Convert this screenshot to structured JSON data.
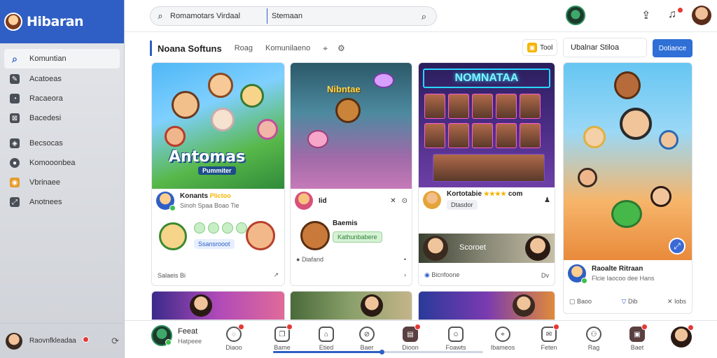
{
  "brand": {
    "title": "Hibaran"
  },
  "sidebar": {
    "items": [
      {
        "label": "Komuntian"
      },
      {
        "label": "Acatoeas"
      },
      {
        "label": "Racaeora"
      },
      {
        "label": "Bacedesi"
      },
      {
        "label": "Becsocas"
      },
      {
        "label": "Komooonbea"
      },
      {
        "label": "Vbrinaee"
      },
      {
        "label": "Anotnees"
      }
    ],
    "user": {
      "name": "Raovnfkleadaa"
    }
  },
  "search": {
    "value": "Romamotars Virdaal",
    "value2": "Stemaan"
  },
  "toolbar": {
    "title": "Noana Softuns",
    "tabs": [
      "Roag",
      "Komunilaeno"
    ],
    "food_label": "Tool",
    "status_label": "Ubalnar Stiloa",
    "primary_label": "Dotiance"
  },
  "cards": {
    "c1": {
      "art_title": "Antomas",
      "art_sub": "Pummiter",
      "name": "Konants",
      "name_tag": "Plictoo",
      "meta": "Sinoh Spaa Boao Tie",
      "chip": "Ssansrooot",
      "foot_left": "Salaeis Bi"
    },
    "c2": {
      "art_title": "Nibntae",
      "name": "Iid",
      "subtitle": "Baemis",
      "chip": "Kathunbabere",
      "foot_left": "Diafand"
    },
    "c3": {
      "neon_title": "NOMNATAA",
      "name": "Kortotabie",
      "name_suffix": "com",
      "stars": "★★★★",
      "chip": "Dtasdor",
      "banner_label": "Scoroet",
      "foot_left": "Bicnfoone",
      "foot_right": "Dv"
    },
    "c4": {
      "name": "Raoalte Ritraan",
      "meta": "Flcie Iaocoo dee Hans",
      "foot_a": "Baoo",
      "foot_b": "Dib",
      "foot_c": "Iobs"
    }
  },
  "dock": {
    "user": {
      "name": "Feeat",
      "meta": "Hatpeee"
    },
    "items": [
      {
        "label": "Diaoo"
      },
      {
        "label": "Bame"
      },
      {
        "label": "Etied"
      },
      {
        "label": "Baer"
      },
      {
        "label": "Dioon"
      },
      {
        "label": "Foawts"
      },
      {
        "label": "Ibameos"
      },
      {
        "label": "Feten"
      },
      {
        "label": "Rag"
      },
      {
        "label": "Baet"
      }
    ]
  }
}
